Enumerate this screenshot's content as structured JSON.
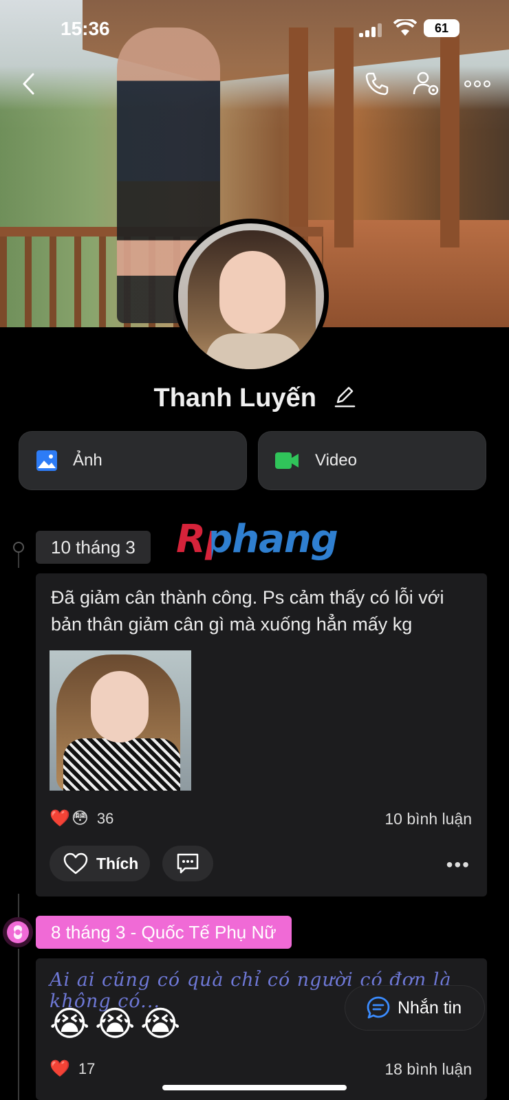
{
  "status": {
    "time": "15:36",
    "battery": "61"
  },
  "profile": {
    "name": "Thanh Luyến"
  },
  "actions": {
    "photo_label": "Ảnh",
    "video_label": "Video"
  },
  "watermark": "Rphang",
  "posts": [
    {
      "date": "10 tháng 3",
      "text": "Đã giảm cân thành công. Ps cảm thấy có lỗi với bản thân giảm cân gì mà xuống hẳn mấy kg",
      "reactions": {
        "emojis": [
          "❤️",
          "😳"
        ],
        "count": "36"
      },
      "comments": "10 bình luận",
      "like_label": "Thích",
      "more": "•••"
    },
    {
      "date": "8 tháng 3 - Quốc Tế Phụ Nữ",
      "text": "Ai ai cũng có quà chỉ có người có đơn là không có...",
      "big_emojis": [
        "😭",
        "😭",
        "😭"
      ],
      "reactions": {
        "emojis": [
          "❤️"
        ],
        "count": "17"
      },
      "comments": "18 bình luận"
    }
  ],
  "message_button": {
    "label": "Nhắn tin"
  },
  "colors": {
    "accent_pink": "#f06ad6",
    "card_bg": "#1c1c1e",
    "blue_icon": "#2d7cf6",
    "green_icon": "#30c45a"
  }
}
